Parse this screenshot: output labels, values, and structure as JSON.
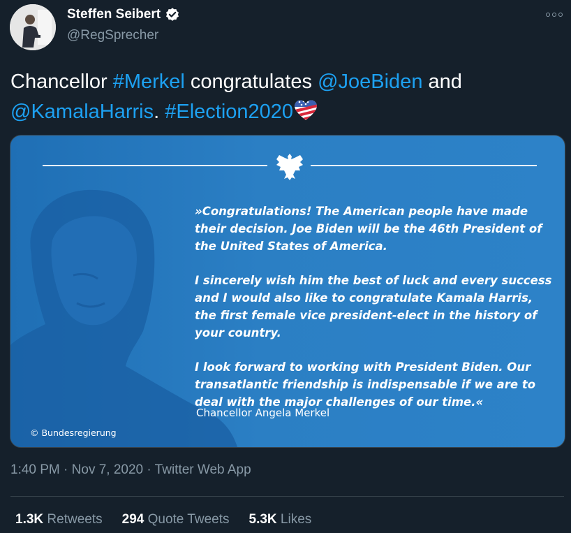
{
  "author": {
    "display_name": "Steffen Seibert",
    "handle": "@RegSprecher",
    "verified": true
  },
  "tweet": {
    "text_parts": [
      {
        "text": "Chancellor ",
        "type": "text"
      },
      {
        "text": "#Merkel",
        "type": "hashtag"
      },
      {
        "text": " congratulates ",
        "type": "text"
      },
      {
        "text": "@JoeBiden",
        "type": "mention"
      },
      {
        "text": " and ",
        "type": "text"
      },
      {
        "text": "@KamalaHarris",
        "type": "mention"
      },
      {
        "text": ". ",
        "type": "text"
      },
      {
        "text": "#Election2020",
        "type": "hashtag"
      }
    ]
  },
  "media": {
    "quote_paragraphs": [
      "»Congratulations! The American people have made their decision. Joe Biden will be the 46th President of the United States of America.",
      "I sincerely wish him the best of luck and every success and I would also like to congratulate Kamala Harris, the first female vice president-elect in the history of your country.",
      "I look forward to working with President Biden. Our transatlantic friendship is indispensable if we are to deal with the major challenges of our time.«"
    ],
    "signature": "Chancellor Angela Merkel",
    "copyright": "© Bundesregierung"
  },
  "meta": {
    "time": "1:40 PM",
    "sep1": " · ",
    "date": "Nov 7, 2020",
    "sep2": " · ",
    "source": "Twitter Web App"
  },
  "stats": {
    "retweets_count": "1.3K",
    "retweets_label": "Retweets",
    "quotes_count": "294",
    "quotes_label": "Quote Tweets",
    "likes_count": "5.3K",
    "likes_label": "Likes"
  },
  "colors": {
    "background": "#15202b",
    "link": "#1da1f2",
    "muted": "#8899a6",
    "media_blue": "#2b7fc4"
  }
}
